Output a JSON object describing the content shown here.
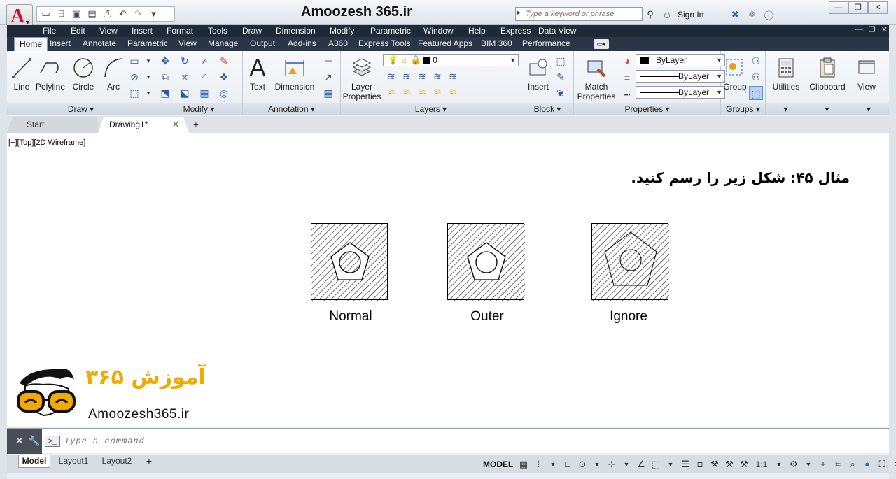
{
  "window": {
    "title": "Amoozesh 365.ir",
    "search_placeholder": "Type a keyword or phrase",
    "sign_in": "Sign In"
  },
  "menubar": [
    "File",
    "Edit",
    "View",
    "Insert",
    "Format",
    "Tools",
    "Draw",
    "Dimension",
    "Modify",
    "Parametric",
    "Window",
    "Help",
    "Express",
    "Data View"
  ],
  "ribbon_tabs": [
    "Home",
    "Insert",
    "Annotate",
    "Parametric",
    "View",
    "Manage",
    "Output",
    "Add-ins",
    "A360",
    "Express Tools",
    "Featured Apps",
    "BIM 360",
    "Performance"
  ],
  "ribbon": {
    "draw": {
      "title": "Draw",
      "tools": [
        "Line",
        "Polyline",
        "Circle",
        "Arc"
      ]
    },
    "modify": {
      "title": "Modify"
    },
    "annotation": {
      "title": "Annotation",
      "tools": [
        "Text",
        "Dimension"
      ]
    },
    "layers": {
      "title": "Layers",
      "layer_properties": "Layer Properties",
      "current_layer": "0"
    },
    "block": {
      "title": "Block",
      "insert": "Insert"
    },
    "properties": {
      "title": "Properties",
      "match": "Match Properties",
      "color": "ByLayer",
      "linetype": "ByLayer",
      "lineweight": "ByLayer"
    },
    "groups": {
      "title": "Groups",
      "group": "Group"
    },
    "utilities": "Utilities",
    "clipboard": "Clipboard",
    "view": "View"
  },
  "file_tabs": {
    "start": "Start",
    "drawing": "Drawing1*"
  },
  "canvas": {
    "viewport_label": "[−][Top][2D Wireframe]",
    "heading": "مثال ۴۵: شکل زیر را رسم کنید.",
    "examples": [
      {
        "label": "Normal"
      },
      {
        "label": "Outer"
      },
      {
        "label": "Ignore"
      }
    ]
  },
  "logo": {
    "farsi": "آموزش ۳۶۵",
    "url": "Amoozesh365.ir",
    "accent": "#f2a900"
  },
  "command_line": {
    "placeholder": "Type a command"
  },
  "status": {
    "layouts": [
      "Model",
      "Layout1",
      "Layout2"
    ],
    "mode": "MODEL",
    "scale": "1:1"
  }
}
